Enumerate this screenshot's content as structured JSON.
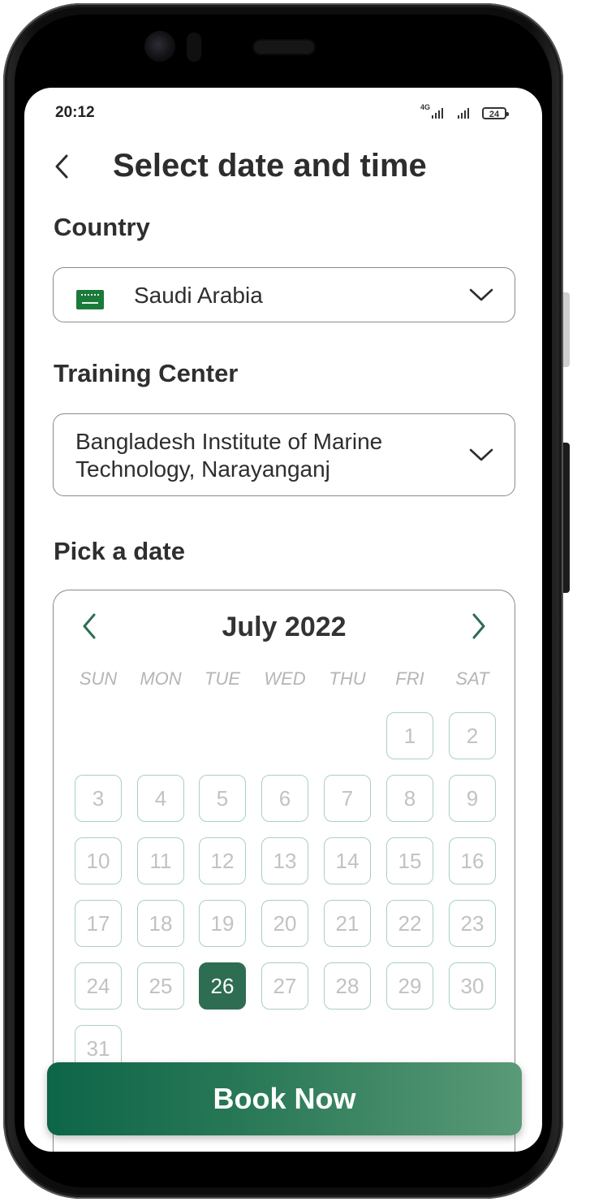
{
  "status_bar": {
    "time": "20:12",
    "network": "4G",
    "battery": "24"
  },
  "header": {
    "title": "Select date and time",
    "back_icon": "chevron-left-icon"
  },
  "country": {
    "label": "Country",
    "value": "Saudi Arabia",
    "flag_icon": "saudi-arabia-flag-icon"
  },
  "training_center": {
    "label": "Training Center",
    "value_line1": "Bangladesh Institute of Marine",
    "value_line2": "Technology, Narayanganj"
  },
  "date_picker": {
    "label": "Pick a date",
    "month": "July 2022",
    "weekdays": [
      "SUN",
      "MON",
      "TUE",
      "WED",
      "THU",
      "FRI",
      "SAT"
    ],
    "first_weekday_index": 5,
    "days_in_month": 31,
    "selected_day": "26",
    "accent_color": "#2e6d52",
    "day_border_color": "#a8d2bd"
  },
  "book_button": {
    "label": "Book Now"
  }
}
